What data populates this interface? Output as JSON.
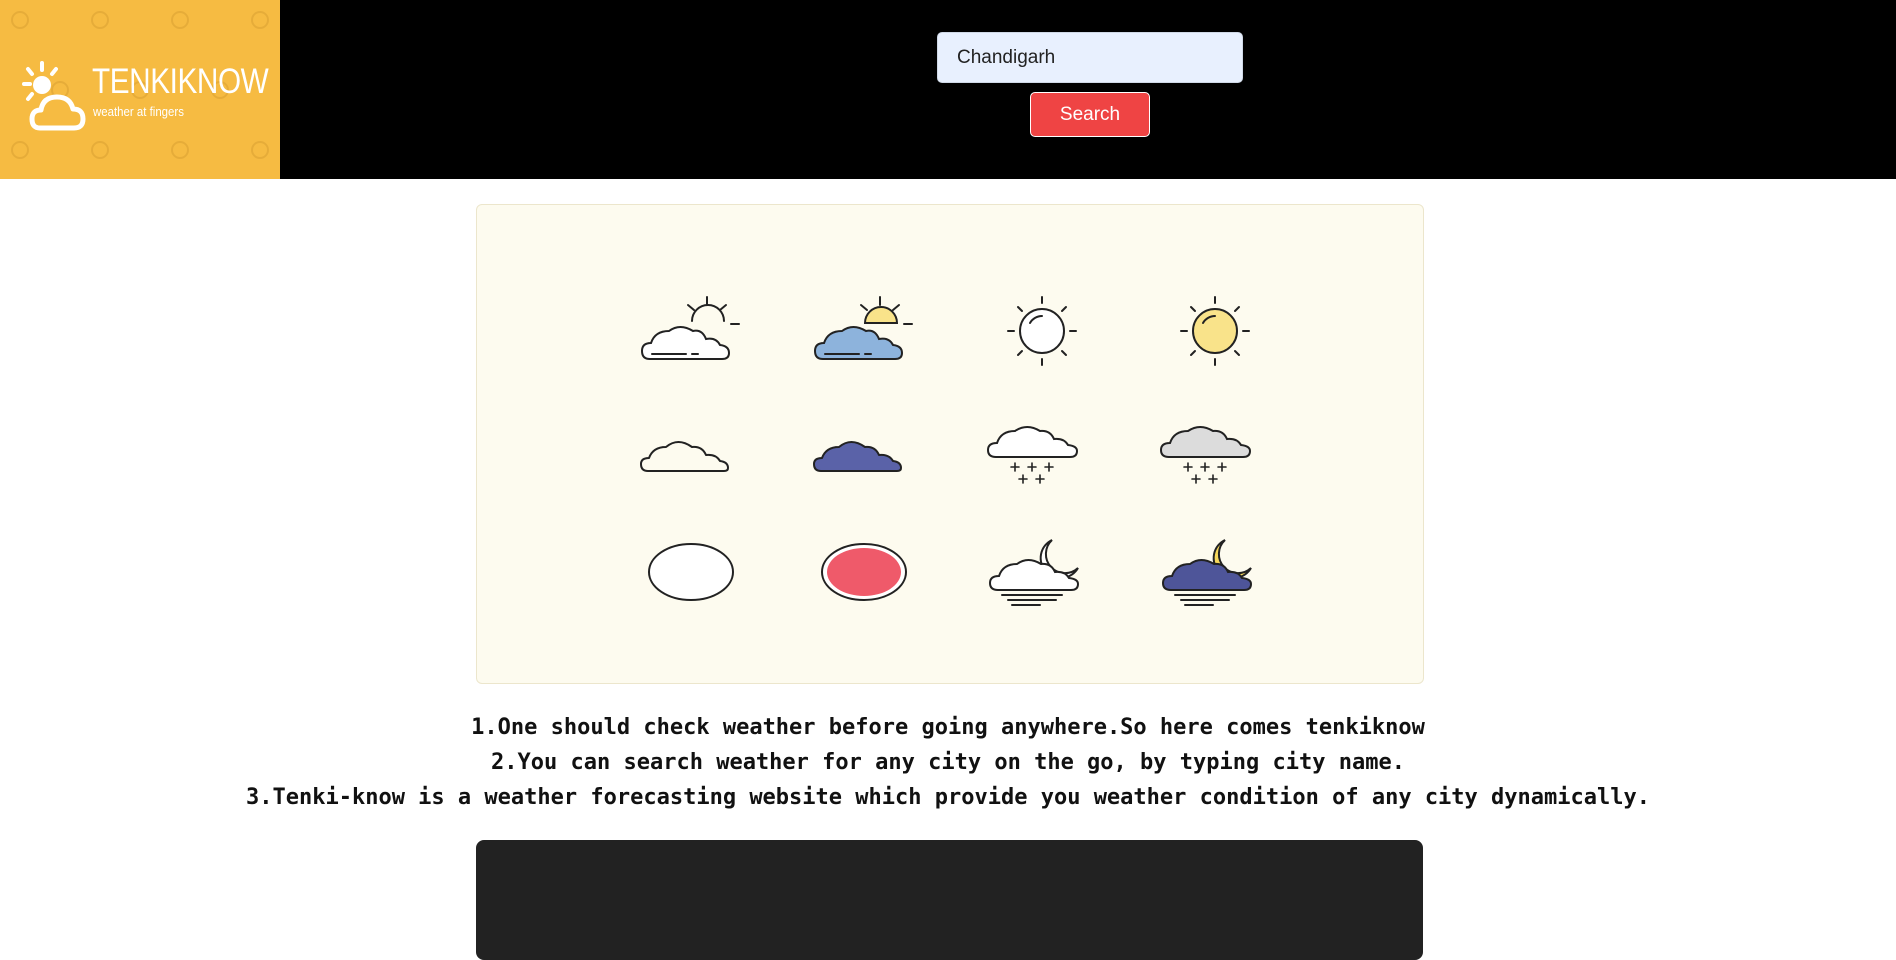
{
  "brand": {
    "title": "TENKIKNOW",
    "tagline": "weather at fingers",
    "color": "#f6bb42"
  },
  "search": {
    "value": "Chandigarh",
    "button_label": "Search",
    "button_color": "#ef4444"
  },
  "icons": [
    "partly-cloudy-outline-icon",
    "partly-cloudy-color-icon",
    "sun-outline-icon",
    "sun-color-icon",
    "cloud-outline-icon",
    "cloud-color-icon",
    "snow-cloud-outline-icon",
    "snow-cloud-color-icon",
    "circle-outline-icon",
    "circle-color-icon",
    "night-fog-outline-icon",
    "night-fog-color-icon"
  ],
  "info": {
    "lines": [
      "1.One should check weather before going anywhere.So here comes tenkiknow",
      "2.You can search weather for any city on the go, by typing city name.",
      "3.Tenki-know is a weather forecasting website which provide you weather condition of any city dynamically."
    ]
  }
}
